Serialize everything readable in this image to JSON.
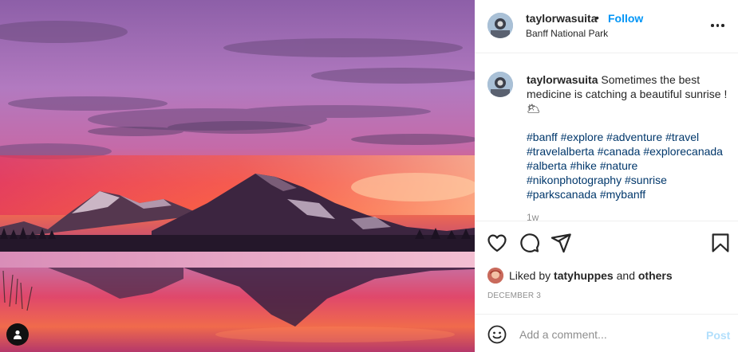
{
  "post": {
    "username": "taylorwasuita",
    "separator": "•",
    "follow_label": "Follow",
    "location": "Banff National Park"
  },
  "caption": {
    "username": "taylorwasuita",
    "text": "Sometimes the best medicine is catching a beautiful sunrise ! 🌥",
    "hashtags": [
      "#banff",
      "#explore",
      "#adventure",
      "#travel",
      "#travelalberta",
      "#canada",
      "#explorecanada",
      "#alberta",
      "#hike",
      "#nature",
      "#nikonphotography",
      "#sunrise",
      "#parkscanada",
      "#mybanff"
    ],
    "time_stub": "1w"
  },
  "actions": {
    "icons": [
      "heart-icon",
      "comment-icon",
      "share-icon",
      "bookmark-icon"
    ]
  },
  "likes": {
    "prefix": "Liked by",
    "user": "tatyhuppes",
    "conjunction": "and",
    "others": "others"
  },
  "date": "DECEMBER 3",
  "comment": {
    "placeholder": "Add a comment...",
    "post_label": "Post"
  },
  "colors": {
    "link_blue": "#0095f6",
    "hashtag_blue": "#00376b",
    "muted": "#8e8e8e",
    "post_disabled": "#b2dffc"
  }
}
